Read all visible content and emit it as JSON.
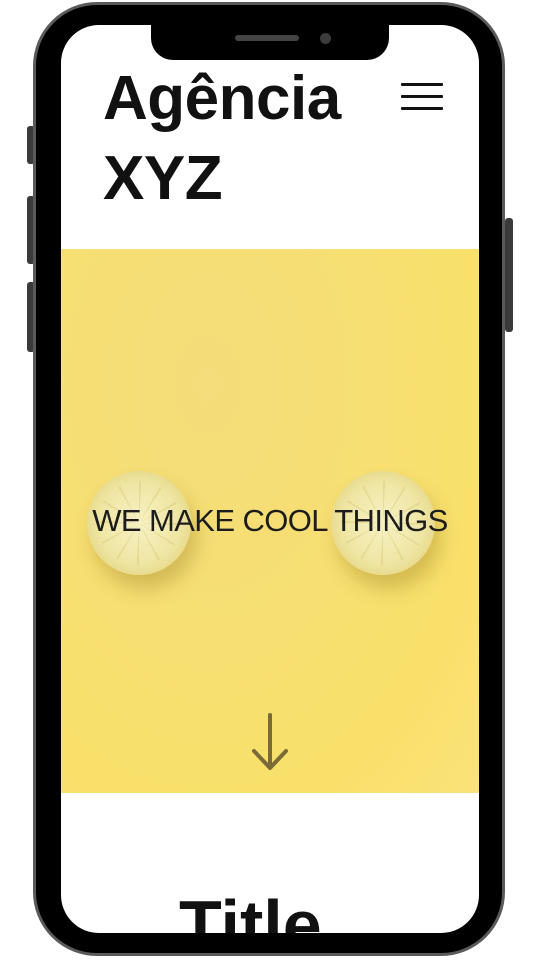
{
  "header": {
    "brand": "Agência XYZ",
    "menu_icon": "hamburger-menu-icon"
  },
  "hero": {
    "tagline": "WE MAKE COOL THINGS",
    "background_color": "#f9e06a",
    "scroll_icon": "arrow-down-icon"
  },
  "section": {
    "title": "Title"
  },
  "colors": {
    "text": "#111111",
    "accent_yellow": "#f9e06a",
    "frame": "#000000"
  }
}
